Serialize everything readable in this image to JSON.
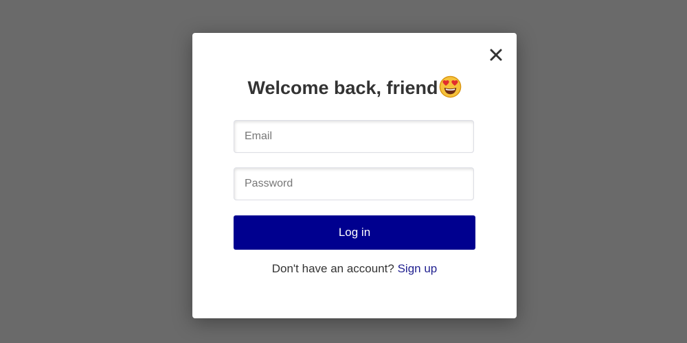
{
  "modal": {
    "title": "Welcome back, friend",
    "title_emoji_icon": "smiling-face-with-heart-eyes-icon",
    "close_icon": "close-icon",
    "email": {
      "placeholder": "Email",
      "value": ""
    },
    "password": {
      "placeholder": "Password",
      "value": ""
    },
    "login_label": "Log in",
    "signup_prompt": "Don't have an account?",
    "signup_link": "Sign up"
  },
  "colors": {
    "overlay": "#6a6a6a",
    "primary_button": "#00008f",
    "link": "#1f1f8f",
    "title_text": "#333333"
  }
}
